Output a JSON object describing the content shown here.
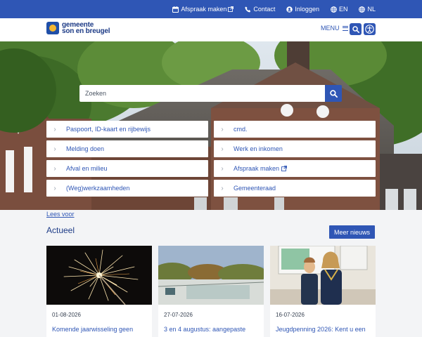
{
  "topbar": {
    "links": [
      {
        "label": "Afspraak maken",
        "icon": "calendar-icon",
        "external": true
      },
      {
        "label": "Contact",
        "icon": "phone-icon",
        "external": false
      },
      {
        "label": "Inloggen",
        "icon": "user-icon",
        "external": false
      },
      {
        "label": "EN",
        "icon": "globe-icon",
        "external": false
      },
      {
        "label": "NL",
        "icon": "globe-icon",
        "external": false
      }
    ]
  },
  "header": {
    "logo_line1": "gemeente",
    "logo_line2": "son en breugel",
    "menu_label": "MENU",
    "search_icon": "search-icon",
    "accessibility_icon": "accessibility-icon"
  },
  "search": {
    "placeholder": "Zoeken"
  },
  "quicklinks": [
    {
      "label": "Paspoort, ID-kaart en rijbewijs",
      "external": false
    },
    {
      "label": "cmd.",
      "external": false
    },
    {
      "label": "Melding doen",
      "external": false
    },
    {
      "label": "Werk en inkomen",
      "external": false
    },
    {
      "label": "Afval en milieu",
      "external": false
    },
    {
      "label": "Afspraak maken",
      "external": true
    },
    {
      "label": "(Weg)werkzaamheden",
      "external": false
    },
    {
      "label": "Gemeenteraad",
      "external": false
    }
  ],
  "content": {
    "read_more": "Lees voor",
    "section_title": "Actueel",
    "more_button": "Meer nieuws"
  },
  "news": [
    {
      "date": "01-08-2026",
      "title": "Komende jaarwisseling geen"
    },
    {
      "date": "27-07-2026",
      "title": "3 en 4 augustus: aangepaste"
    },
    {
      "date": "16-07-2026",
      "title": "Jeugdpenning 2026: Kent u een"
    }
  ],
  "colors": {
    "primary": "#2f56b5",
    "dark_blue": "#1d3b86",
    "logo_yellow": "#f2b632"
  }
}
